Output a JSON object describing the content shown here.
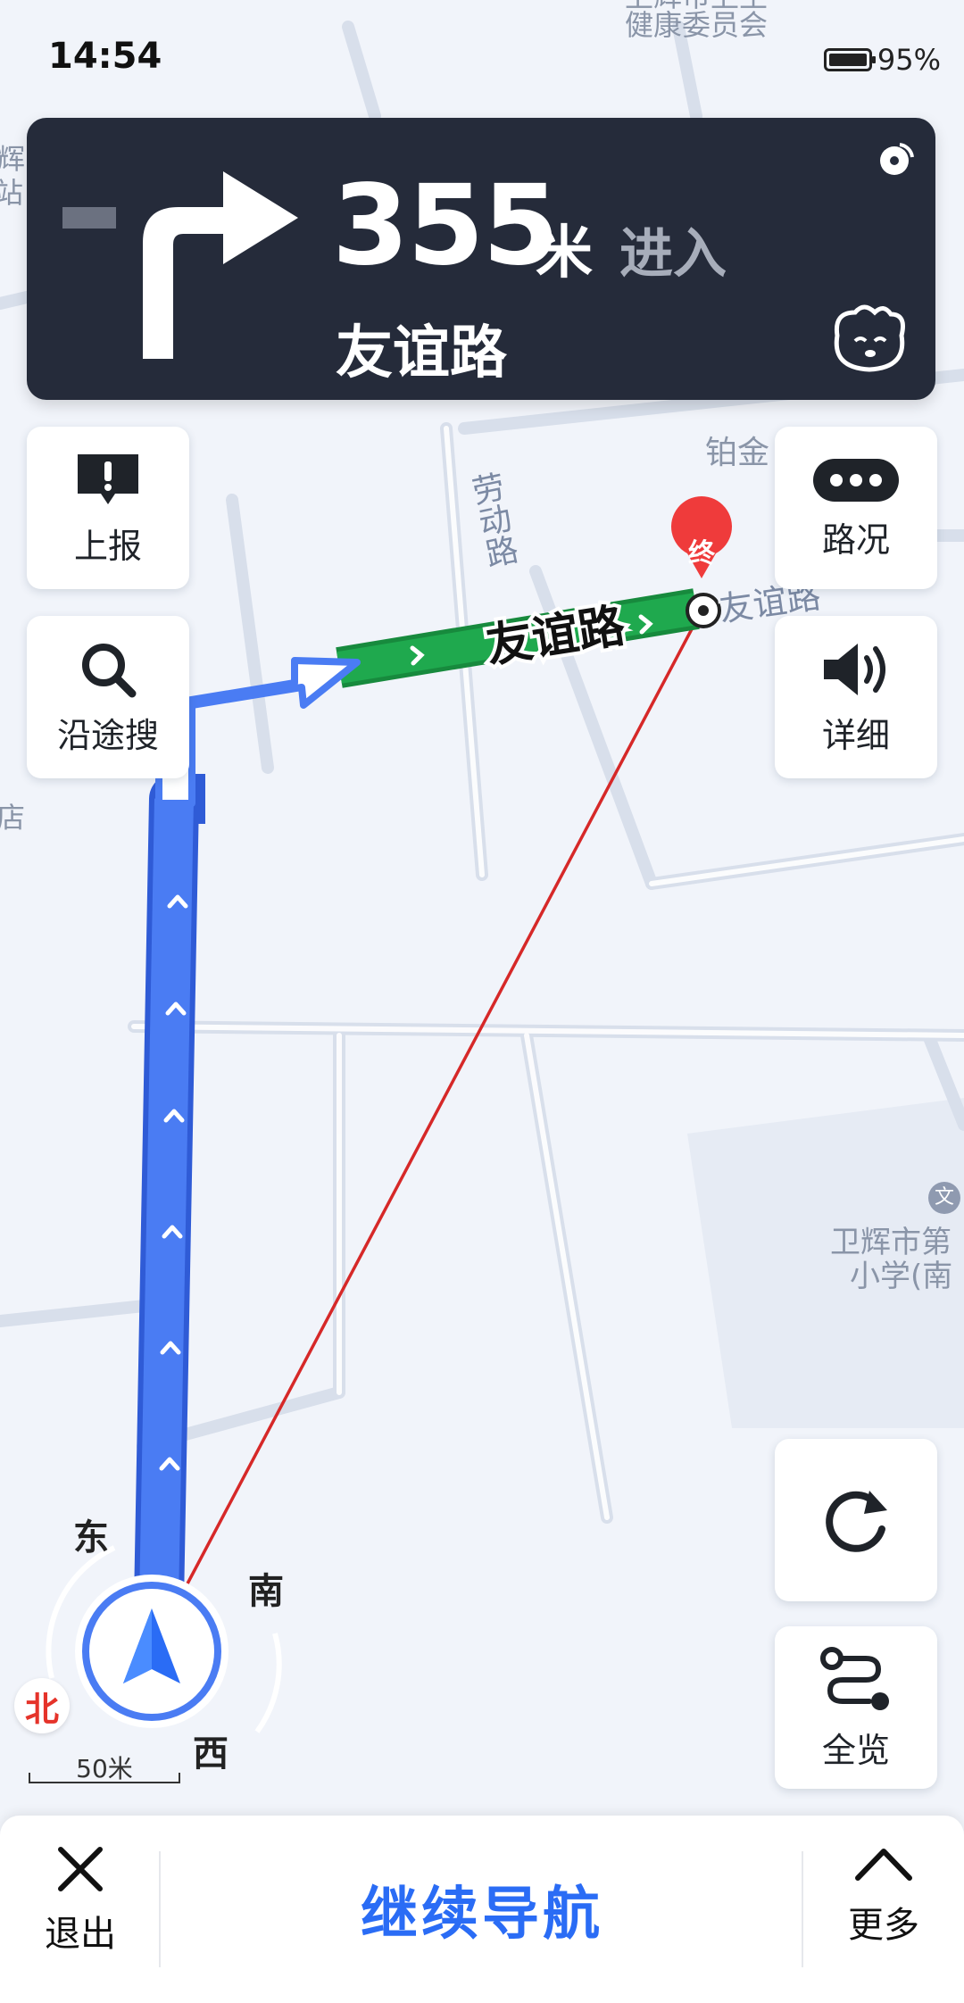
{
  "status_bar": {
    "time": "14:54",
    "battery_percent": "95%",
    "battery_level": 0.95
  },
  "guidance": {
    "distance": "355",
    "unit": "米",
    "action": "进入",
    "road_name": "友谊路",
    "turn_direction": "right",
    "icons": [
      "navigation-signal-icon",
      "assistant-mascot-icon"
    ]
  },
  "left_buttons": [
    {
      "label": "上报",
      "icon": "report-alert-icon"
    },
    {
      "label": "沿途搜",
      "icon": "search-icon"
    }
  ],
  "right_buttons": [
    {
      "label": "路况",
      "icon": "traffic-dots-icon"
    },
    {
      "label": "详细",
      "icon": "speaker-icon"
    },
    {
      "label": "",
      "icon": "refresh-icon"
    },
    {
      "label": "全览",
      "icon": "route-overview-icon"
    }
  ],
  "map": {
    "road_label_main": "友谊路",
    "road_label_side": "友谊路",
    "street_laodong": "劳动路",
    "poi_top": "健康委员会",
    "poi_top_partial": "卫辉市卫生",
    "poi_bojin": "铂金",
    "poi_school_line1": "卫辉市第",
    "poi_school_line2": "小学(南",
    "poi_school_icon": "文",
    "poi_left_top1": "卫辉",
    "poi_left_top2": "站",
    "poi_left_mid": "店",
    "destination_marker": "终"
  },
  "compass": {
    "east": "东",
    "south": "南",
    "west": "西",
    "north": "北"
  },
  "scale": {
    "text": "50米"
  },
  "bottom_bar": {
    "exit": "退出",
    "continue": "继续导航",
    "more": "更多"
  },
  "colors": {
    "route_blue": "#4a7cf3",
    "route_green": "#1fa94e",
    "card_bg": "#252b3a",
    "accent_blue": "#2a6cf5",
    "destination_red": "#e5332a"
  }
}
